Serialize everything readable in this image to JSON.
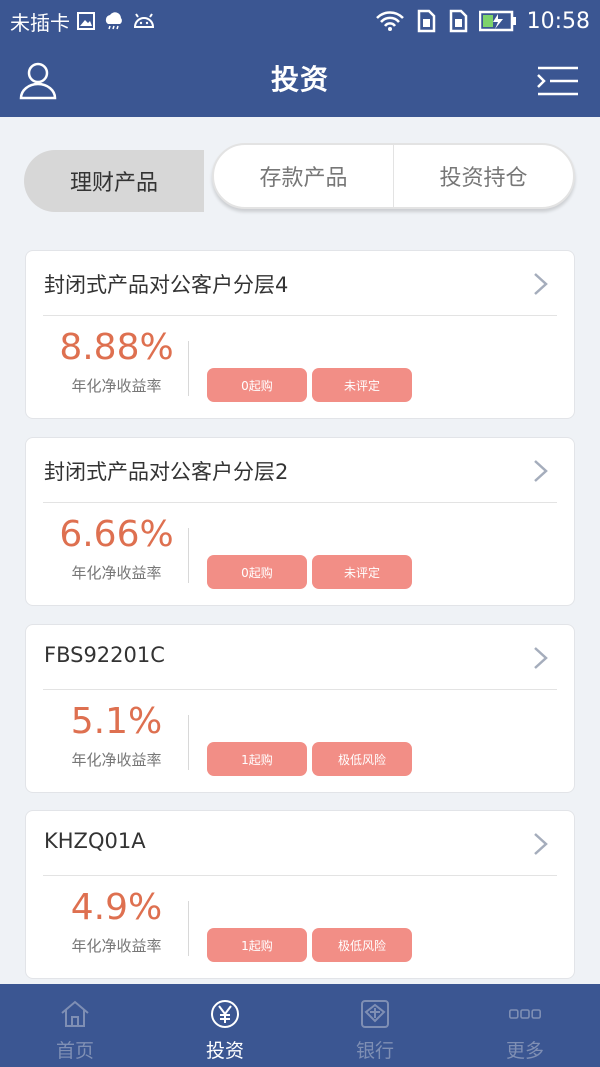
{
  "status_bar": {
    "carrier": "未插卡",
    "time": "10:58",
    "icons": [
      "image-icon",
      "cloud-icon",
      "android-icon",
      "wifi-icon",
      "sim-icon",
      "sim-icon",
      "battery-charging-icon"
    ]
  },
  "header": {
    "title": "投资",
    "left_icon": "user-icon",
    "right_icon": "menu-icon"
  },
  "segments": {
    "active": "理财产品",
    "tabs": [
      "存款产品",
      "投资持仓"
    ]
  },
  "products": [
    {
      "name": "封闭式产品对公客户分层4",
      "rate": "8.88%",
      "rate_label": "年化净收益率",
      "min_buy": "0起购",
      "risk": "未评定"
    },
    {
      "name": "封闭式产品对公客户分层2",
      "rate": "6.66%",
      "rate_label": "年化净收益率",
      "min_buy": "0起购",
      "risk": "未评定"
    },
    {
      "name": "FBS92201C",
      "rate": "5.1%",
      "rate_label": "年化净收益率",
      "min_buy": "1起购",
      "risk": "极低风险"
    },
    {
      "name": "KHZQ01A",
      "rate": "4.9%",
      "rate_label": "年化净收益率",
      "min_buy": "1起购",
      "risk": "极低风险"
    }
  ],
  "bottom_nav": [
    {
      "label": "首页",
      "icon": "home-icon",
      "active": false
    },
    {
      "label": "投资",
      "icon": "yen-icon",
      "active": true
    },
    {
      "label": "银行",
      "icon": "bank-icon",
      "active": false
    },
    {
      "label": "更多",
      "icon": "more-icon",
      "active": false
    }
  ],
  "colors": {
    "primary": "#3b5692",
    "background": "#eff2f6",
    "rate": "#de7050",
    "tag": "#f28e86",
    "nav_inactive": "#7f8fb4"
  }
}
